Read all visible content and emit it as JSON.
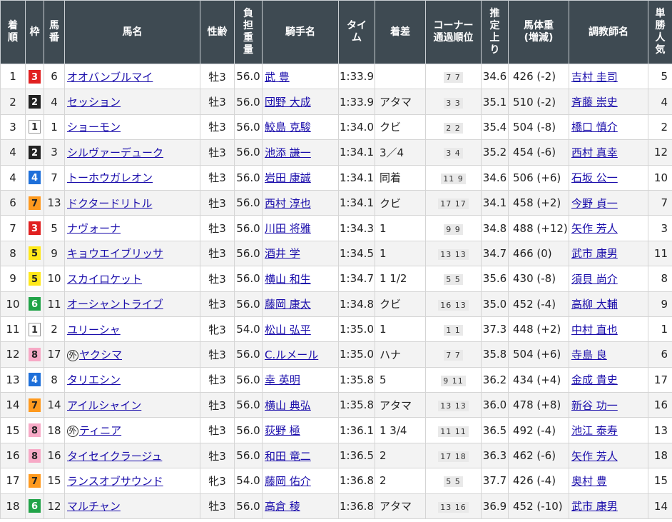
{
  "headers": [
    "着順",
    "枠",
    "馬番",
    "馬名",
    "性齢",
    "負担重量",
    "騎手名",
    "タイム",
    "着差",
    "コーナー通過順位",
    "推定上り",
    "馬体重(増減)",
    "調教師名",
    "単勝人気"
  ],
  "header_lines": {
    "rank": [
      "着",
      "順"
    ],
    "waku": [
      "枠"
    ],
    "umaban": [
      "馬",
      "番"
    ],
    "horse": [
      "馬名"
    ],
    "sexage": [
      "性齢"
    ],
    "weight": [
      "負",
      "担",
      "重",
      "量"
    ],
    "jockey": [
      "騎手名"
    ],
    "time": [
      "タイ",
      "ム"
    ],
    "margin": [
      "着差"
    ],
    "corner": [
      "コーナー",
      "通過順位"
    ],
    "agari": [
      "推",
      "定",
      "上",
      "り"
    ],
    "bodyweight": [
      "馬体重",
      "(増減)"
    ],
    "trainer": [
      "調教師名"
    ],
    "pop": [
      "単",
      "勝",
      "人",
      "気"
    ]
  },
  "waku_colors": {
    "1": {
      "bg": "#ffffff",
      "fg": "#333333",
      "border": "#999999"
    },
    "2": {
      "bg": "#222222",
      "fg": "#ffffff",
      "border": "#222222"
    },
    "3": {
      "bg": "#e02020",
      "fg": "#ffffff",
      "border": "#e02020"
    },
    "4": {
      "bg": "#1e6fd9",
      "fg": "#ffffff",
      "border": "#1e6fd9"
    },
    "5": {
      "bg": "#ffe81a",
      "fg": "#222222",
      "border": "#ffe81a"
    },
    "6": {
      "bg": "#21a348",
      "fg": "#ffffff",
      "border": "#21a348"
    },
    "7": {
      "bg": "#ff9a1f",
      "fg": "#222222",
      "border": "#ff9a1f"
    },
    "8": {
      "bg": "#f7a9c6",
      "fg": "#222222",
      "border": "#f7a9c6"
    }
  },
  "rows": [
    {
      "rank": "1",
      "waku": "3",
      "umaban": "6",
      "mark": "",
      "horse": "オオバンブルマイ",
      "sexage": "牡3",
      "weight": "56.0",
      "jockey": "武 豊",
      "time": "1:33.9",
      "margin": "",
      "corner": "7 7",
      "agari": "34.6",
      "bodyweight": "426 (-2)",
      "trainer": "吉村 圭司",
      "pop": "5"
    },
    {
      "rank": "2",
      "waku": "2",
      "umaban": "4",
      "mark": "",
      "horse": "セッション",
      "sexage": "牡3",
      "weight": "56.0",
      "jockey": "団野 大成",
      "time": "1:33.9",
      "margin": "アタマ",
      "corner": "3 3",
      "agari": "35.1",
      "bodyweight": "510 (-2)",
      "trainer": "斉藤 崇史",
      "pop": "4"
    },
    {
      "rank": "3",
      "waku": "1",
      "umaban": "1",
      "mark": "",
      "horse": "ショーモン",
      "sexage": "牡3",
      "weight": "56.0",
      "jockey": "鮫島 克駿",
      "time": "1:34.0",
      "margin": "クビ",
      "corner": "2 2",
      "agari": "35.4",
      "bodyweight": "504 (-8)",
      "trainer": "橋口 慎介",
      "pop": "2"
    },
    {
      "rank": "4",
      "waku": "2",
      "umaban": "3",
      "mark": "",
      "horse": "シルヴァーデューク",
      "sexage": "牡3",
      "weight": "56.0",
      "jockey": "池添 謙一",
      "time": "1:34.1",
      "margin": "3／4",
      "corner": "3 4",
      "agari": "35.2",
      "bodyweight": "454 (-6)",
      "trainer": "西村 真幸",
      "pop": "12"
    },
    {
      "rank": "4",
      "waku": "4",
      "umaban": "7",
      "mark": "",
      "horse": "トーホウガレオン",
      "sexage": "牡3",
      "weight": "56.0",
      "jockey": "岩田 康誠",
      "time": "1:34.1",
      "margin": "同着",
      "corner": "11 9",
      "agari": "34.6",
      "bodyweight": "506 (+6)",
      "trainer": "石坂 公一",
      "pop": "10"
    },
    {
      "rank": "6",
      "waku": "7",
      "umaban": "13",
      "mark": "",
      "horse": "ドクタードリトル",
      "sexage": "牡3",
      "weight": "56.0",
      "jockey": "西村 淳也",
      "time": "1:34.1",
      "margin": "クビ",
      "corner": "17 17",
      "agari": "34.1",
      "bodyweight": "458 (+2)",
      "trainer": "今野 貞一",
      "pop": "7"
    },
    {
      "rank": "7",
      "waku": "3",
      "umaban": "5",
      "mark": "",
      "horse": "ナヴォーナ",
      "sexage": "牡3",
      "weight": "56.0",
      "jockey": "川田 将雅",
      "time": "1:34.3",
      "margin": "1",
      "corner": "9 9",
      "agari": "34.8",
      "bodyweight": "488 (+12)",
      "trainer": "矢作 芳人",
      "pop": "3"
    },
    {
      "rank": "8",
      "waku": "5",
      "umaban": "9",
      "mark": "",
      "horse": "キョウエイブリッサ",
      "sexage": "牡3",
      "weight": "56.0",
      "jockey": "酒井 学",
      "time": "1:34.5",
      "margin": "1",
      "corner": "13 13",
      "agari": "34.7",
      "bodyweight": "466 (0)",
      "trainer": "武市 康男",
      "pop": "11"
    },
    {
      "rank": "9",
      "waku": "5",
      "umaban": "10",
      "mark": "",
      "horse": "スカイロケット",
      "sexage": "牡3",
      "weight": "56.0",
      "jockey": "横山 和生",
      "time": "1:34.7",
      "margin": "1 1/2",
      "corner": "5 5",
      "agari": "35.6",
      "bodyweight": "430 (-8)",
      "trainer": "須貝 尚介",
      "pop": "8"
    },
    {
      "rank": "10",
      "waku": "6",
      "umaban": "11",
      "mark": "",
      "horse": "オーシャントライブ",
      "sexage": "牡3",
      "weight": "56.0",
      "jockey": "藤岡 康太",
      "time": "1:34.8",
      "margin": "クビ",
      "corner": "16 13",
      "agari": "35.0",
      "bodyweight": "452 (-4)",
      "trainer": "高柳 大輔",
      "pop": "9"
    },
    {
      "rank": "11",
      "waku": "1",
      "umaban": "2",
      "mark": "",
      "horse": "ユリーシャ",
      "sexage": "牝3",
      "weight": "54.0",
      "jockey": "松山 弘平",
      "time": "1:35.0",
      "margin": "1",
      "corner": "1 1",
      "agari": "37.3",
      "bodyweight": "448 (+2)",
      "trainer": "中村 直也",
      "pop": "1"
    },
    {
      "rank": "12",
      "waku": "8",
      "umaban": "17",
      "mark": "外",
      "horse": "ヤクシマ",
      "sexage": "牡3",
      "weight": "56.0",
      "jockey": "C.ルメール",
      "time": "1:35.0",
      "margin": "ハナ",
      "corner": "7 7",
      "agari": "35.8",
      "bodyweight": "504 (+6)",
      "trainer": "寺島 良",
      "pop": "6"
    },
    {
      "rank": "13",
      "waku": "4",
      "umaban": "8",
      "mark": "",
      "horse": "タリエシン",
      "sexage": "牡3",
      "weight": "56.0",
      "jockey": "幸 英明",
      "time": "1:35.8",
      "margin": "5",
      "corner": "9 11",
      "agari": "36.2",
      "bodyweight": "434 (+4)",
      "trainer": "金成 貴史",
      "pop": "17"
    },
    {
      "rank": "14",
      "waku": "7",
      "umaban": "14",
      "mark": "",
      "horse": "アイルシャイン",
      "sexage": "牡3",
      "weight": "56.0",
      "jockey": "横山 典弘",
      "time": "1:35.8",
      "margin": "アタマ",
      "corner": "13 13",
      "agari": "36.0",
      "bodyweight": "478 (+8)",
      "trainer": "新谷 功一",
      "pop": "16"
    },
    {
      "rank": "15",
      "waku": "8",
      "umaban": "18",
      "mark": "外",
      "horse": "ティニア",
      "sexage": "牡3",
      "weight": "56.0",
      "jockey": "荻野 極",
      "time": "1:36.1",
      "margin": "1 3/4",
      "corner": "11 11",
      "agari": "36.5",
      "bodyweight": "492 (-4)",
      "trainer": "池江 泰寿",
      "pop": "13"
    },
    {
      "rank": "16",
      "waku": "8",
      "umaban": "16",
      "mark": "",
      "horse": "タイセイクラージュ",
      "sexage": "牡3",
      "weight": "56.0",
      "jockey": "和田 竜二",
      "time": "1:36.5",
      "margin": "2",
      "corner": "17 18",
      "agari": "36.3",
      "bodyweight": "462 (-6)",
      "trainer": "矢作 芳人",
      "pop": "18"
    },
    {
      "rank": "17",
      "waku": "7",
      "umaban": "15",
      "mark": "",
      "horse": "ランスオブサウンド",
      "sexage": "牝3",
      "weight": "54.0",
      "jockey": "藤岡 佑介",
      "time": "1:36.8",
      "margin": "2",
      "corner": "5 5",
      "agari": "37.7",
      "bodyweight": "426 (-4)",
      "trainer": "奥村 豊",
      "pop": "15"
    },
    {
      "rank": "18",
      "waku": "6",
      "umaban": "12",
      "mark": "",
      "horse": "マルチャン",
      "sexage": "牡3",
      "weight": "56.0",
      "jockey": "高倉 稜",
      "time": "1:36.8",
      "margin": "アタマ",
      "corner": "13 16",
      "agari": "36.9",
      "bodyweight": "452 (-10)",
      "trainer": "武市 康男",
      "pop": "14"
    }
  ]
}
